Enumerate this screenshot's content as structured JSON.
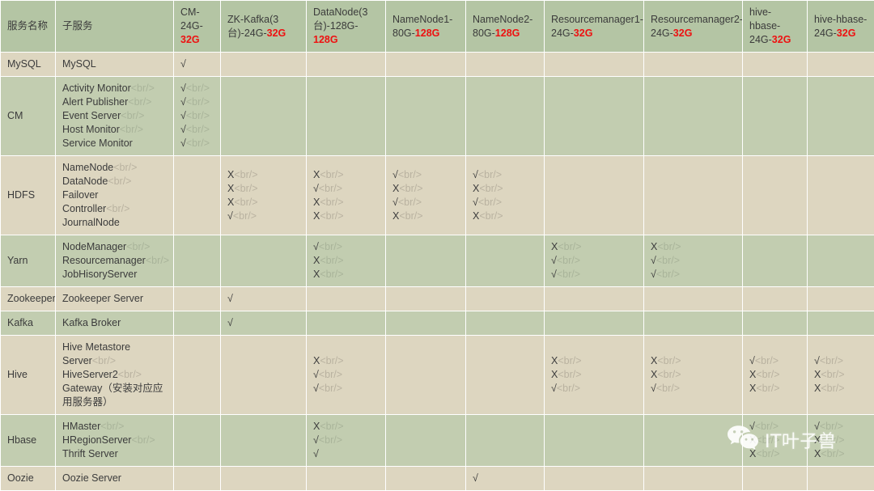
{
  "table": {
    "headers": [
      {
        "line1": "服务名称",
        "line2": "",
        "hl": ""
      },
      {
        "line1": "子服务",
        "line2": "",
        "hl": ""
      },
      {
        "line1": "CM-",
        "line2": "24G-",
        "hl": "32G"
      },
      {
        "line1": "ZK-Kafka(3",
        "line2": "台)-24G-",
        "hl": "32G"
      },
      {
        "line1": "DataNode(3",
        "line2": "台)-128G-",
        "hl": "128G"
      },
      {
        "line1": "NameNode1-",
        "line2": "80G-",
        "hl": "128G"
      },
      {
        "line1": "NameNode2-",
        "line2": "80G-",
        "hl": "128G"
      },
      {
        "line1": "Resourcemanager1-",
        "line2": "24G-",
        "hl": "32G"
      },
      {
        "line1": "Resourcemanager2-",
        "line2": "24G-",
        "hl": "32G"
      },
      {
        "line1": "hive-hbase-",
        "line2": "24G-",
        "hl": "32G"
      },
      {
        "line1": "hive-hbase-",
        "line2": "24G-",
        "hl": "32G"
      }
    ],
    "rows": [
      {
        "band": "band-a",
        "service": "MySQL",
        "sub": [
          {
            "t": "MySQL",
            "br": false
          }
        ],
        "cells": [
          [
            {
              "t": "√",
              "br": false
            }
          ],
          [],
          [],
          [],
          [],
          [],
          [],
          [],
          []
        ]
      },
      {
        "band": "band-b",
        "service": "CM",
        "sub": [
          {
            "t": "Activity Monitor",
            "br": true
          },
          {
            "t": "Alert Publisher",
            "br": true
          },
          {
            "t": "Event Server",
            "br": true
          },
          {
            "t": "Host Monitor",
            "br": true
          },
          {
            "t": "Service Monitor",
            "br": false
          }
        ],
        "cells": [
          [
            {
              "t": "√",
              "br": true
            },
            {
              "t": "√",
              "br": true
            },
            {
              "t": "√",
              "br": true
            },
            {
              "t": "√",
              "br": true
            },
            {
              "t": "√",
              "br": true
            }
          ],
          [],
          [],
          [],
          [],
          [],
          [],
          [],
          []
        ]
      },
      {
        "band": "band-a",
        "service": "HDFS",
        "sub": [
          {
            "t": "NameNode",
            "br": true
          },
          {
            "t": "DataNode",
            "br": true
          },
          {
            "t": "Failover Controller",
            "br": true
          },
          {
            "t": "JournalNode",
            "br": false
          }
        ],
        "cells": [
          [],
          [
            {
              "t": "X",
              "br": true
            },
            {
              "t": "X",
              "br": true
            },
            {
              "t": "X",
              "br": true
            },
            {
              "t": "√",
              "br": true
            }
          ],
          [
            {
              "t": "X",
              "br": true
            },
            {
              "t": "√",
              "br": true
            },
            {
              "t": "X",
              "br": true
            },
            {
              "t": "X",
              "br": true
            }
          ],
          [
            {
              "t": "√",
              "br": true
            },
            {
              "t": "X",
              "br": true
            },
            {
              "t": "√",
              "br": true
            },
            {
              "t": "X",
              "br": true
            }
          ],
          [
            {
              "t": "√",
              "br": true
            },
            {
              "t": "X",
              "br": true
            },
            {
              "t": "√",
              "br": true
            },
            {
              "t": "X",
              "br": true
            }
          ],
          [],
          [],
          [],
          []
        ]
      },
      {
        "band": "band-b",
        "service": "Yarn",
        "sub": [
          {
            "t": "NodeManager",
            "br": true
          },
          {
            "t": "Resourcemanager",
            "br": true
          },
          {
            "t": "JobHisoryServer",
            "br": false
          }
        ],
        "cells": [
          [],
          [],
          [
            {
              "t": "√",
              "br": true
            },
            {
              "t": "X",
              "br": true
            },
            {
              "t": "X",
              "br": true
            }
          ],
          [],
          [],
          [
            {
              "t": "X",
              "br": true
            },
            {
              "t": "√",
              "br": true
            },
            {
              "t": "√",
              "br": true
            }
          ],
          [
            {
              "t": "X",
              "br": true
            },
            {
              "t": "√",
              "br": true
            },
            {
              "t": "√",
              "br": true
            }
          ],
          [],
          []
        ]
      },
      {
        "band": "band-a",
        "service": "Zookeeper",
        "sub": [
          {
            "t": "Zookeeper Server",
            "br": false
          }
        ],
        "cells": [
          [],
          [
            {
              "t": "√",
              "br": false
            }
          ],
          [],
          [],
          [],
          [],
          [],
          [],
          []
        ]
      },
      {
        "band": "band-b",
        "service": "Kafka",
        "sub": [
          {
            "t": "Kafka Broker",
            "br": false
          }
        ],
        "cells": [
          [],
          [
            {
              "t": "√",
              "br": false
            }
          ],
          [],
          [],
          [],
          [],
          [],
          [],
          []
        ]
      },
      {
        "band": "band-a",
        "service": "Hive",
        "sub": [
          {
            "t": "Hive Metastore Server",
            "br": true
          },
          {
            "t": "HiveServer2",
            "br": true
          },
          {
            "t": "Gateway（安装对应应用服务器）",
            "br": false
          }
        ],
        "cells": [
          [],
          [],
          [
            {
              "t": "X",
              "br": true
            },
            {
              "t": "√",
              "br": true
            },
            {
              "t": "√",
              "br": true
            }
          ],
          [],
          [],
          [
            {
              "t": "X",
              "br": true
            },
            {
              "t": "X",
              "br": true
            },
            {
              "t": "√",
              "br": true
            }
          ],
          [
            {
              "t": "X",
              "br": true
            },
            {
              "t": "X",
              "br": true
            },
            {
              "t": "√",
              "br": true
            }
          ],
          [
            {
              "t": "√",
              "br": true
            },
            {
              "t": "X",
              "br": true
            },
            {
              "t": "X",
              "br": true
            }
          ],
          [
            {
              "t": "√",
              "br": true
            },
            {
              "t": "X",
              "br": true
            },
            {
              "t": "X",
              "br": true
            }
          ]
        ]
      },
      {
        "band": "band-b",
        "service": "Hbase",
        "sub": [
          {
            "t": "HMaster",
            "br": true
          },
          {
            "t": "HRegionServer",
            "br": true
          },
          {
            "t": "Thrift Server",
            "br": false
          }
        ],
        "cells": [
          [],
          [],
          [
            {
              "t": "X",
              "br": true
            },
            {
              "t": "√",
              "br": true
            },
            {
              "t": "√",
              "br": false
            }
          ],
          [],
          [],
          [],
          [],
          [
            {
              "t": "√",
              "br": true
            },
            {
              "t": "X",
              "br": true
            },
            {
              "t": "X",
              "br": true
            }
          ],
          [
            {
              "t": "√",
              "br": true
            },
            {
              "t": "X",
              "br": true
            },
            {
              "t": "X",
              "br": true
            }
          ]
        ]
      },
      {
        "band": "band-a",
        "service": "Oozie",
        "sub": [
          {
            "t": "Oozie Server",
            "br": false
          }
        ],
        "cells": [
          [],
          [],
          [],
          [],
          [
            {
              "t": "√",
              "br": false
            }
          ],
          [],
          [],
          [],
          []
        ]
      }
    ]
  },
  "watermark": {
    "text": "IT叶子兽",
    "icon": "wechat-icon"
  },
  "colors": {
    "header_bg": "#b4c5a4",
    "band_a": "#ddd6c0",
    "band_b": "#c2cdb0",
    "highlight": "#ee1111",
    "tag_text": "#b9b2a0"
  }
}
